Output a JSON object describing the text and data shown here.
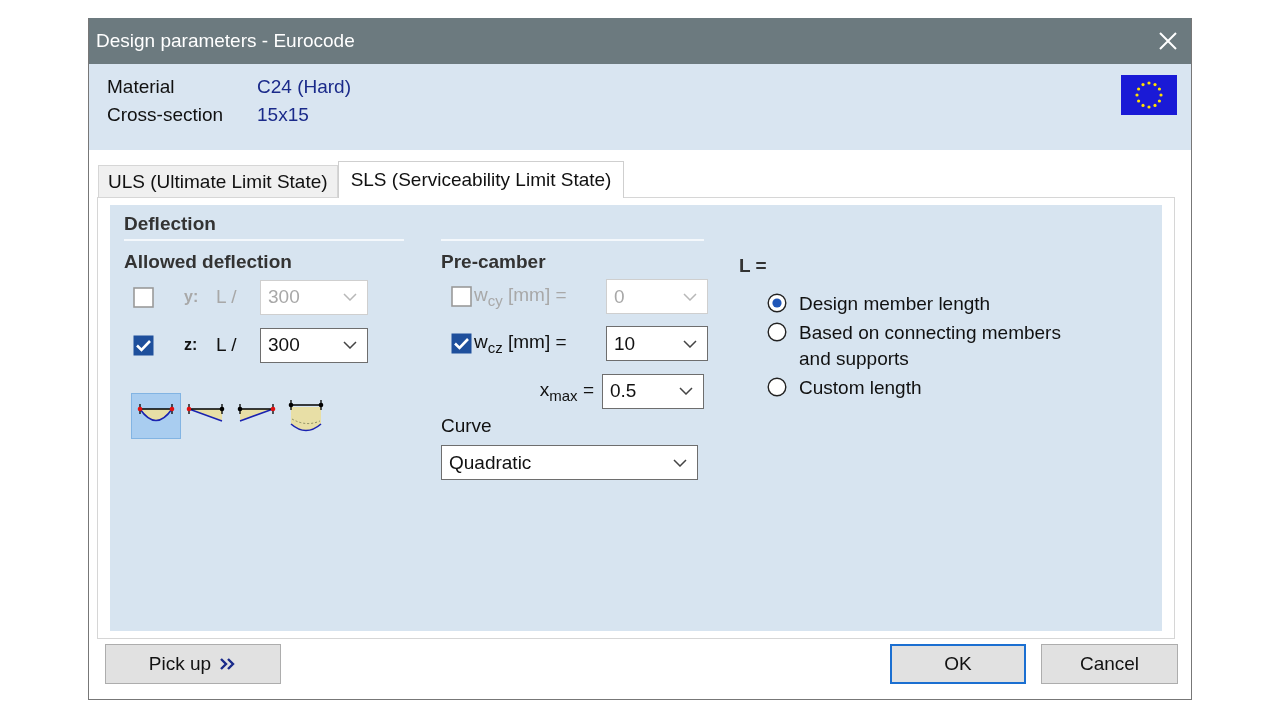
{
  "window": {
    "title": "Design parameters - Eurocode"
  },
  "header": {
    "fields": [
      {
        "label": "Material",
        "value": "C24 (Hard)"
      },
      {
        "label": "Cross-section",
        "value": "15x15"
      }
    ]
  },
  "tabs": [
    {
      "label": "ULS (Ultimate Limit State)",
      "selected": false
    },
    {
      "label": "SLS (Serviceability Limit State)",
      "selected": true
    }
  ],
  "deflection": {
    "title": "Deflection",
    "allowed": {
      "title": "Allowed deflection",
      "rows": [
        {
          "axis": "y:",
          "label": "L /",
          "value": "300",
          "checked": false,
          "disabled": true
        },
        {
          "axis": "z:",
          "label": "L /",
          "value": "300",
          "checked": true,
          "disabled": false
        }
      ],
      "shapes": [
        {
          "kind": "sag",
          "selected": true
        },
        {
          "kind": "left",
          "selected": false
        },
        {
          "kind": "right",
          "selected": false
        },
        {
          "kind": "deep",
          "selected": false
        }
      ]
    },
    "precamber": {
      "title": "Pre-camber",
      "rows": [
        {
          "label": "w$_{cy}$ [mm] =",
          "value": "0",
          "checked": false,
          "disabled": true
        },
        {
          "label": "w$_{cz}$ [mm] =",
          "value": "10",
          "checked": true,
          "disabled": false
        }
      ],
      "xmax": {
        "label": "x$_{max}$ =",
        "value": "0.5"
      },
      "curve": {
        "label": "Curve",
        "value": "Quadratic"
      }
    },
    "length": {
      "label": "L =",
      "options": [
        {
          "label": "Design member length",
          "selected": true
        },
        {
          "label": "Based on connecting members and supports",
          "selected": false
        },
        {
          "label": "Custom length",
          "selected": false
        }
      ]
    }
  },
  "buttons": [
    {
      "label": "Pick up",
      "kind": "pickup"
    },
    {
      "label": "OK",
      "kind": "default"
    },
    {
      "label": "Cancel",
      "kind": "normal"
    }
  ]
}
